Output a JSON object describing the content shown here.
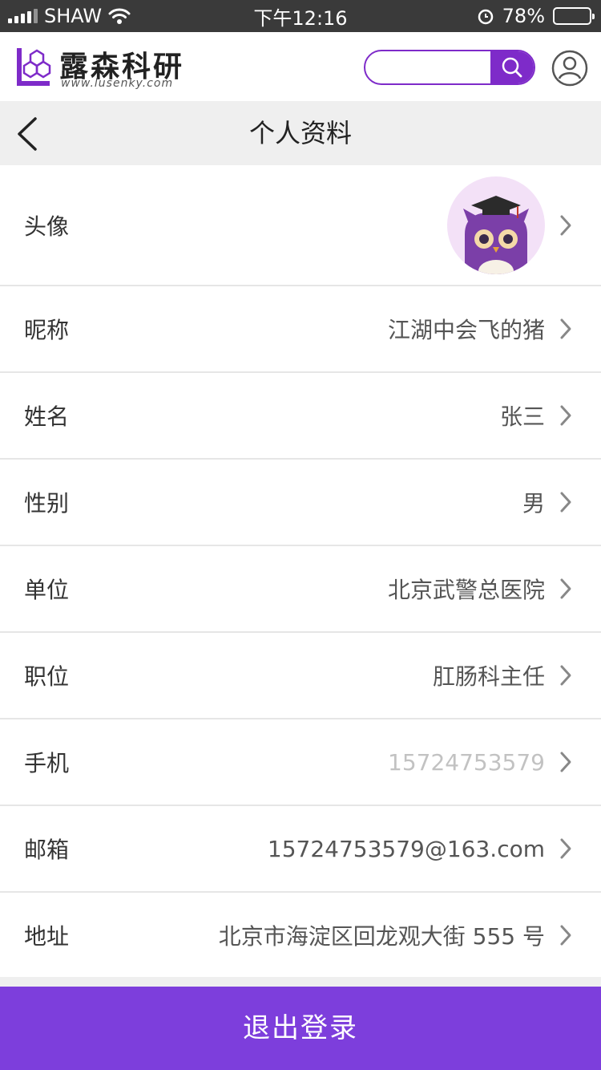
{
  "status_bar": {
    "carrier": "SHAW",
    "time": "下午12:16",
    "battery_percent": "78%",
    "battery_level": 0.78
  },
  "header": {
    "logo_title": "露森科研",
    "logo_url": "www.lusenky.com",
    "search_placeholder": "",
    "search_value": "",
    "brand_color": "#7e2bc9",
    "icons": {
      "search": "search-icon",
      "user": "user-icon"
    }
  },
  "nav": {
    "back_icon": "back-arrow-icon",
    "title": "个人资料"
  },
  "profile": {
    "avatar_label": "头像",
    "rows": [
      {
        "label": "昵称",
        "value": "江湖中会飞的猪"
      },
      {
        "label": "姓名",
        "value": "张三"
      },
      {
        "label": "性别",
        "value": "男"
      },
      {
        "label": "单位",
        "value": "北京武警总医院"
      },
      {
        "label": "职位",
        "value": "肛肠科主任"
      },
      {
        "label": "手机",
        "value": "15724753579"
      },
      {
        "label": "邮箱",
        "value": "15724753579@163.com"
      },
      {
        "label": "地址",
        "value": "北京市海淀区回龙观大街 555 号"
      }
    ]
  },
  "footer": {
    "logout_label": "退出登录",
    "button_color": "#7d3edc"
  }
}
